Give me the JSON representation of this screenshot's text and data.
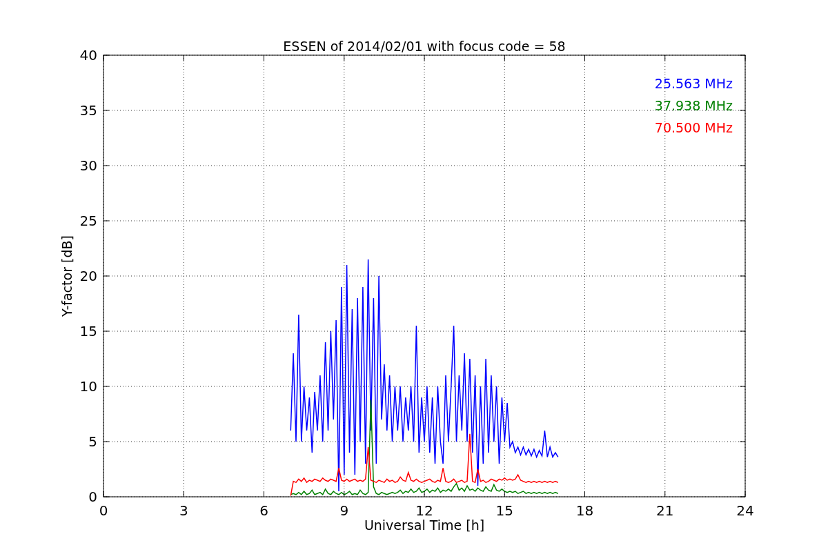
{
  "chart_data": {
    "type": "line",
    "title": "ESSEN of 2014/02/01 with focus code = 58",
    "xlabel": "Universal Time [h]",
    "ylabel": "Y-factor [dB]",
    "x": [
      7.0,
      7.1,
      7.2,
      7.3,
      7.4,
      7.5,
      7.6,
      7.7,
      7.8,
      7.9,
      8.0,
      8.1,
      8.2,
      8.3,
      8.4,
      8.5,
      8.6,
      8.7,
      8.8,
      8.9,
      9.0,
      9.1,
      9.2,
      9.3,
      9.4,
      9.5,
      9.6,
      9.7,
      9.8,
      9.9,
      10.0,
      10.1,
      10.2,
      10.3,
      10.4,
      10.5,
      10.6,
      10.7,
      10.8,
      10.9,
      11.0,
      11.1,
      11.2,
      11.3,
      11.4,
      11.5,
      11.6,
      11.7,
      11.8,
      11.9,
      12.0,
      12.1,
      12.2,
      12.3,
      12.4,
      12.5,
      12.6,
      12.7,
      12.8,
      12.9,
      13.0,
      13.1,
      13.2,
      13.3,
      13.4,
      13.5,
      13.6,
      13.7,
      13.8,
      13.9,
      14.0,
      14.1,
      14.2,
      14.3,
      14.4,
      14.5,
      14.6,
      14.7,
      14.8,
      14.9,
      15.0,
      15.1,
      15.2,
      15.3,
      15.4,
      15.5,
      15.6,
      15.7,
      15.8,
      15.9,
      16.0,
      16.1,
      16.2,
      16.3,
      16.4,
      16.5,
      16.6,
      16.7,
      16.8,
      16.9,
      17.0
    ],
    "series": [
      {
        "name": "25.563 MHz",
        "color": "#0000ff",
        "values": [
          6,
          13,
          5,
          16.5,
          5,
          10,
          6,
          9,
          4,
          9.5,
          6,
          11,
          5,
          14,
          6,
          15,
          7,
          16,
          0.5,
          19,
          2,
          21,
          4,
          17,
          2,
          18,
          5,
          19,
          3,
          21.5,
          6,
          18,
          3,
          20,
          7,
          12,
          6,
          11,
          5,
          10,
          6,
          10,
          5,
          9,
          6,
          10,
          5,
          15.5,
          4,
          9,
          5,
          10,
          4,
          9,
          3,
          10,
          5,
          3,
          11,
          5,
          10,
          15.5,
          5,
          11,
          6,
          13,
          5,
          12.5,
          4,
          11,
          1,
          10,
          3,
          12.5,
          4,
          11,
          5,
          10,
          3,
          9,
          5,
          8.5,
          4.5,
          5,
          4,
          4.5,
          3.8,
          4.5,
          3.8,
          4.3,
          3.7,
          4.3,
          3.6,
          4.2,
          3.7,
          6,
          3.6,
          4.5,
          3.6,
          4,
          3.6
        ]
      },
      {
        "name": "37.938 MHz",
        "color": "#008000",
        "values": [
          0.2,
          0.3,
          0.2,
          0.4,
          0.2,
          0.5,
          0.2,
          0.3,
          0.6,
          0.2,
          0.3,
          0.4,
          0.2,
          0.7,
          0.3,
          0.2,
          0.5,
          0.3,
          0.2,
          0.4,
          0.2,
          0.3,
          0.5,
          0.2,
          0.3,
          0.2,
          0.6,
          0.3,
          0.2,
          0.4,
          8.8,
          0.9,
          0.3,
          0.2,
          0.4,
          0.3,
          0.2,
          0.3,
          0.4,
          0.3,
          0.4,
          0.6,
          0.3,
          0.5,
          0.4,
          0.7,
          0.4,
          0.5,
          0.8,
          0.4,
          0.5,
          0.7,
          0.4,
          0.6,
          0.5,
          0.8,
          0.4,
          0.6,
          0.5,
          0.7,
          0.5,
          0.9,
          1.2,
          0.6,
          0.8,
          0.5,
          1.0,
          0.6,
          0.7,
          0.5,
          0.8,
          0.6,
          0.5,
          0.9,
          0.6,
          0.5,
          1.1,
          0.6,
          0.5,
          0.7,
          0.5,
          0.4,
          0.5,
          0.4,
          0.5,
          0.3,
          0.4,
          0.5,
          0.3,
          0.4,
          0.3,
          0.4,
          0.3,
          0.4,
          0.3,
          0.4,
          0.3,
          0.4,
          0.3,
          0.4,
          0.3
        ]
      },
      {
        "name": "70.500 MHz",
        "color": "#ff0000",
        "values": [
          0.1,
          1.4,
          1.3,
          1.6,
          1.4,
          1.7,
          1.3,
          1.5,
          1.4,
          1.6,
          1.5,
          1.4,
          1.7,
          1.5,
          1.4,
          1.6,
          1.5,
          1.4,
          2.6,
          1.5,
          1.4,
          1.6,
          1.4,
          1.5,
          1.6,
          1.4,
          1.5,
          1.4,
          1.6,
          4.5,
          1.5,
          1.4,
          1.3,
          1.5,
          1.4,
          1.3,
          1.6,
          1.4,
          1.5,
          1.3,
          1.4,
          1.8,
          1.5,
          1.4,
          2.2,
          1.5,
          1.4,
          1.6,
          1.4,
          1.3,
          1.4,
          1.5,
          1.6,
          1.4,
          1.3,
          1.5,
          1.4,
          2.6,
          1.4,
          1.3,
          1.4,
          1.6,
          1.3,
          1.4,
          1.5,
          1.3,
          1.4,
          5.7,
          1.4,
          1.3,
          2.5,
          1.4,
          1.5,
          1.3,
          1.4,
          1.6,
          1.5,
          1.4,
          1.6,
          1.5,
          1.7,
          1.5,
          1.6,
          1.5,
          1.6,
          2.0,
          1.5,
          1.4,
          1.3,
          1.4,
          1.3,
          1.4,
          1.3,
          1.4,
          1.3,
          1.4,
          1.3,
          1.4,
          1.3,
          1.4,
          1.3
        ]
      }
    ],
    "grid": true,
    "xlim": [
      0,
      24
    ],
    "ylim": [
      0,
      40
    ],
    "xticks": [
      0,
      3,
      6,
      9,
      12,
      15,
      18,
      21,
      24
    ],
    "yticks": [
      0,
      5,
      10,
      15,
      20,
      25,
      30,
      35,
      40
    ]
  }
}
